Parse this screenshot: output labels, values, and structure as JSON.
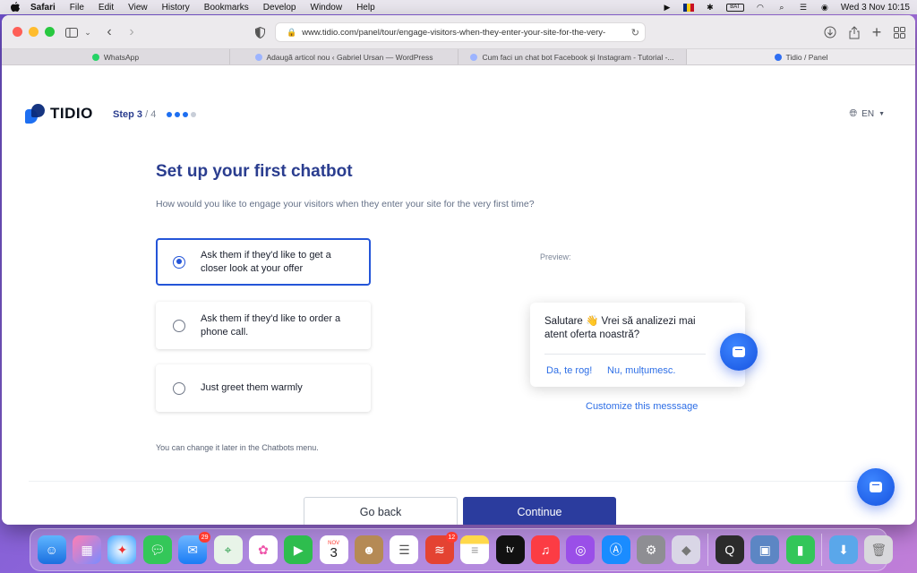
{
  "menubar": {
    "app": "Safari",
    "items": [
      "File",
      "Edit",
      "View",
      "History",
      "Bookmarks",
      "Develop",
      "Window",
      "Help"
    ],
    "battery": "BAT",
    "clock": "Wed 3 Nov  10:15"
  },
  "browser": {
    "url": "www.tidio.com/panel/tour/engage-visitors-when-they-enter-your-site-for-the-very-",
    "tabs": [
      {
        "label": "WhatsApp",
        "color": "#25d366"
      },
      {
        "label": "Adaugă articol nou ‹ Gabriel Ursan — WordPress",
        "color": "#9db4ff"
      },
      {
        "label": "Cum faci un chat bot Facebook și Instagram - Tutorial -...",
        "color": "#9db4ff"
      },
      {
        "label": "Tidio / Panel",
        "color": "#2f6ef2"
      }
    ]
  },
  "tidio": {
    "logo_text": "TIDIO",
    "step_label": "Step 3",
    "step_total": "/ 4",
    "language": "EN",
    "heading": "Set up your first chatbot",
    "subheading": "How would you like to engage your visitors when they enter your site for the very first time?",
    "options": [
      {
        "label": "Ask them if they'd like to get a closer look at your offer",
        "selected": true
      },
      {
        "label": "Ask them if they'd like to order a phone call.",
        "selected": false
      },
      {
        "label": "Just greet them warmly",
        "selected": false
      }
    ],
    "note": "You can change it later in the Chatbots menu.",
    "preview_label": "Preview:",
    "preview_message": "Salutare 👋 Vrei să analizezi mai atent oferta noastră?",
    "preview_yes": "Da, te rog!",
    "preview_no": "Nu, mulțumesc.",
    "customize": "Customize this messsage",
    "back_button": "Go back",
    "continue_button": "Continue"
  },
  "dock": {
    "calendar_month": "NOV",
    "calendar_day": "3",
    "mail_badge": "29",
    "todoist_badge": "12",
    "tv_label": "tv"
  },
  "colors": {
    "brand_blue": "#2a3d8f",
    "accent": "#2455d8",
    "continue_bg": "#2b3c9e"
  }
}
